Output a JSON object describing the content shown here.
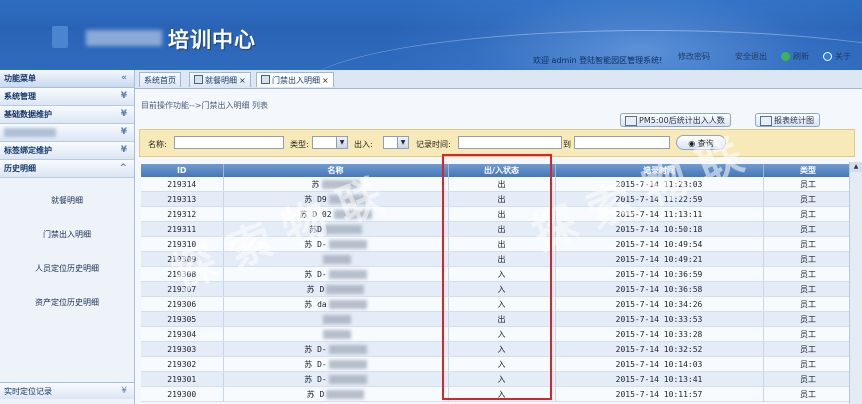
{
  "header": {
    "title": "培训中心",
    "welcome": "欢迎 admin 登陆智能园区管理系统!",
    "links": [
      {
        "label": "修改密码",
        "icon": "key-icon"
      },
      {
        "label": "安全退出",
        "icon": "exit-icon"
      },
      {
        "label": "刷新",
        "icon": "refresh-icon"
      },
      {
        "label": "关于",
        "icon": "info-icon"
      }
    ]
  },
  "sidebar": {
    "title": "功能菜单",
    "items": [
      {
        "label": "系统管理"
      },
      {
        "label": "基础数据维护"
      },
      {
        "label": ""
      },
      {
        "label": "标签绑定维护"
      },
      {
        "label": "历史明细"
      }
    ],
    "subitems": [
      "就餐明细",
      "门禁出入明细",
      "人员定位历史明细",
      "资产定位历史明细"
    ],
    "bottom": "实时定位记录"
  },
  "tabs": [
    {
      "label": "系统首页"
    },
    {
      "label": "就餐明细"
    },
    {
      "label": "门禁出入明细"
    }
  ],
  "main": {
    "breadcrumb": "目前操作功能-->门禁出入明细 列表",
    "btn_stats": "PM5:00后统计出入人数",
    "btn_report": "报表统计图",
    "search": {
      "name_label": "名称:",
      "type_label": "类型:",
      "inout_label": "出入:",
      "time_label": "记录时间:",
      "to_label": "到",
      "query": "查询"
    }
  },
  "table": {
    "headers": [
      "ID",
      "名称",
      "出/入状态",
      "记录时间",
      "类型"
    ],
    "rows": [
      {
        "id": "219314",
        "name": "苏",
        "status": "出",
        "time": "2015-7-14 11:23:03",
        "type": "员工"
      },
      {
        "id": "219313",
        "name": "苏 D9",
        "status": "出",
        "time": "2015-7-14 11:22:59",
        "type": "员工"
      },
      {
        "id": "219312",
        "name": "苏 D 02",
        "status": "出",
        "time": "2015-7-14 11:13:11",
        "type": "员工"
      },
      {
        "id": "219311",
        "name": "苏D",
        "status": "出",
        "time": "2015-7-14 10:50:18",
        "type": "员工"
      },
      {
        "id": "219310",
        "name": "苏 D-",
        "status": "出",
        "time": "2015-7-14 10:49:54",
        "type": "员工"
      },
      {
        "id": "219309",
        "name": "",
        "status": "出",
        "time": "2015-7-14 10:49:21",
        "type": "员工"
      },
      {
        "id": "219308",
        "name": "苏 D-",
        "status": "入",
        "time": "2015-7-14 10:36:59",
        "type": "员工"
      },
      {
        "id": "219307",
        "name": "苏 D",
        "status": "入",
        "time": "2015-7-14 10:36:58",
        "type": "员工"
      },
      {
        "id": "219306",
        "name": "苏 da",
        "status": "入",
        "time": "2015-7-14 10:34:26",
        "type": "员工"
      },
      {
        "id": "219305",
        "name": "",
        "status": "出",
        "time": "2015-7-14 10:33:53",
        "type": "员工"
      },
      {
        "id": "219304",
        "name": "",
        "status": "入",
        "time": "2015-7-14 10:33:28",
        "type": "员工"
      },
      {
        "id": "219303",
        "name": "苏 D-",
        "status": "入",
        "time": "2015-7-14 10:32:52",
        "type": "员工"
      },
      {
        "id": "219302",
        "name": "苏 D-",
        "status": "入",
        "time": "2015-7-14 10:14:03",
        "type": "员工"
      },
      {
        "id": "219301",
        "name": "苏 D-",
        "status": "入",
        "time": "2015-7-14 10:13:41",
        "type": "员工"
      },
      {
        "id": "219300",
        "name": "苏 D",
        "status": "入",
        "time": "2015-7-14 10:11:57",
        "type": "员工"
      }
    ]
  },
  "colors": {
    "highlight": "#d9242a",
    "header_blue": "#2d6fc2",
    "search_bg": "#f8e9b8"
  }
}
